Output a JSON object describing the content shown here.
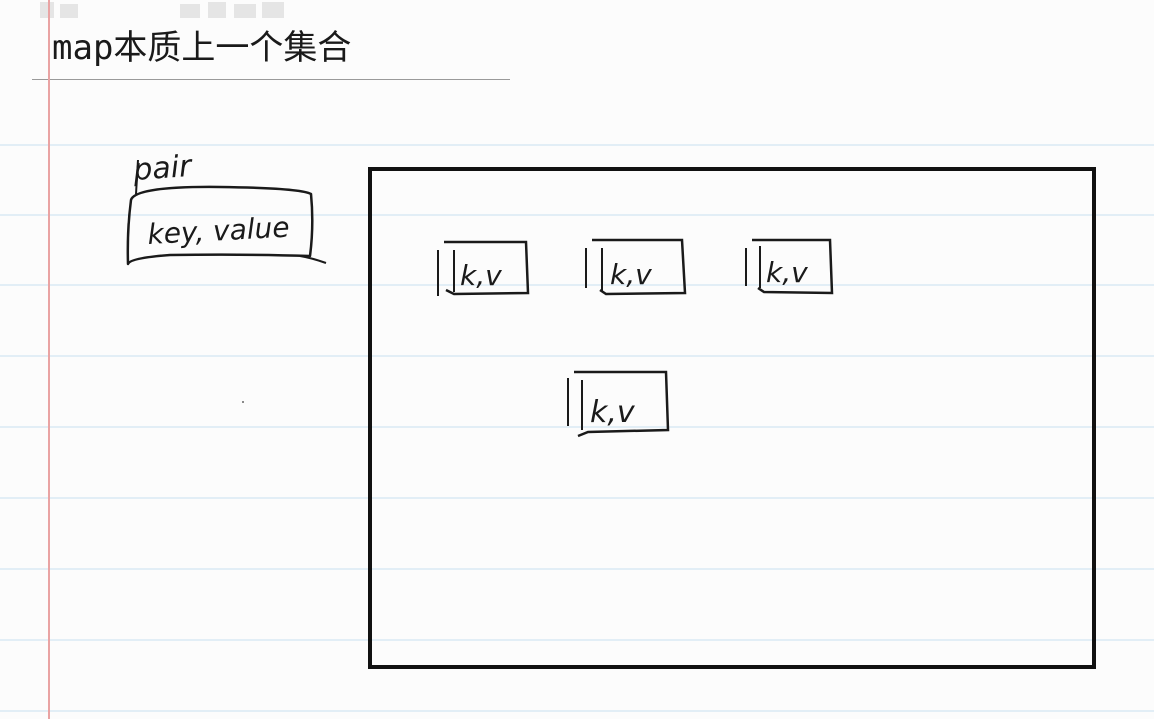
{
  "page": {
    "title": "map本质上一个集合",
    "line_color": "#c9dff0",
    "margin_color": "#e9a3a3",
    "background": "#fcfcfc",
    "ink_color": "#1a1a1a"
  },
  "pair_note": {
    "label": "pair",
    "content": "key, value"
  },
  "container": {
    "entries": [
      {
        "text": "k,v"
      },
      {
        "text": "k,v"
      },
      {
        "text": "k,v"
      },
      {
        "text": "k,v"
      }
    ]
  }
}
